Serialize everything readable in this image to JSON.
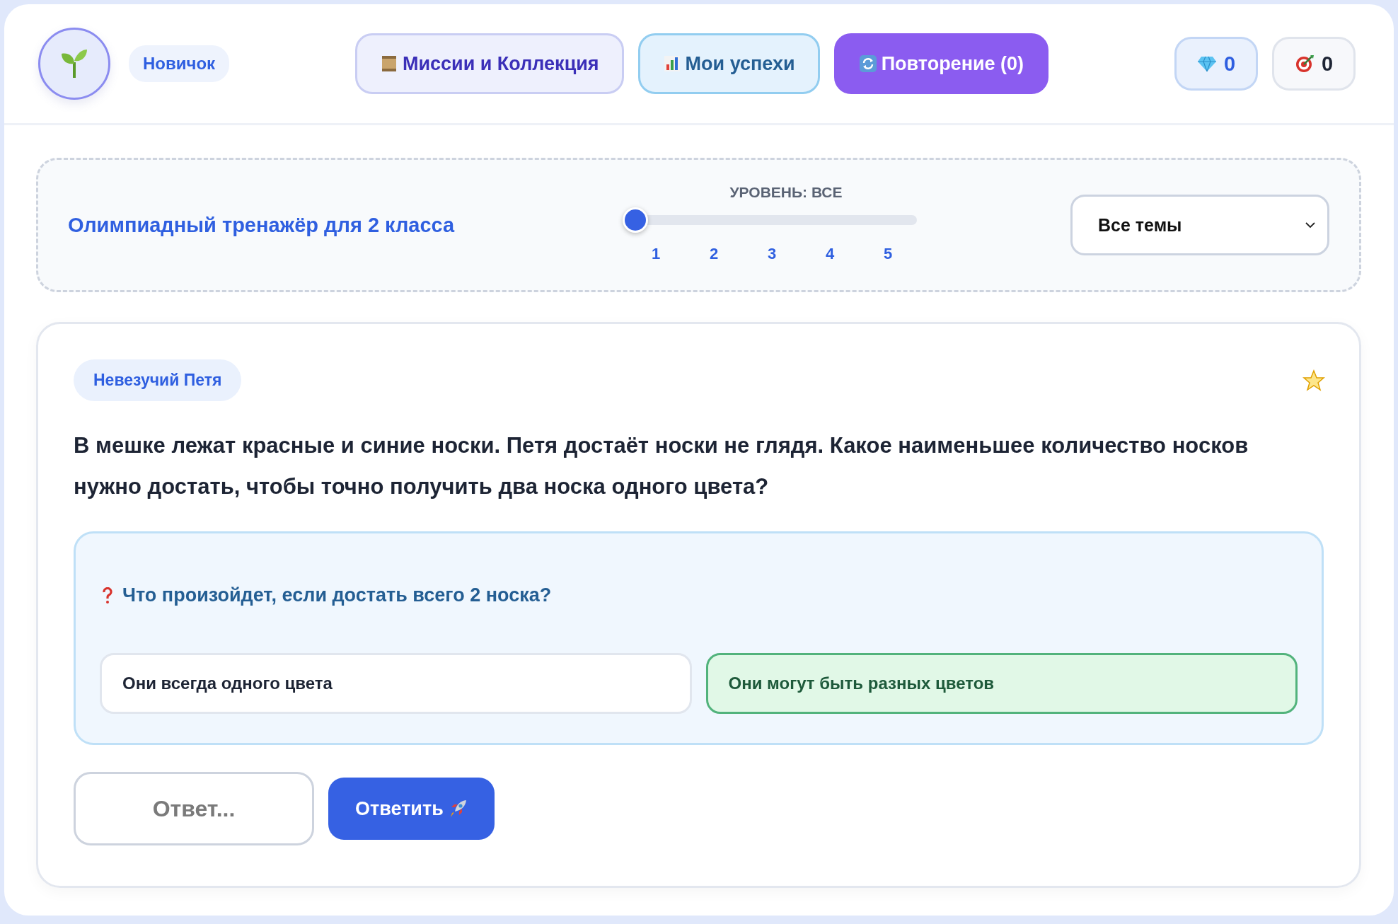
{
  "header": {
    "rank": "Новичок",
    "nav": [
      {
        "kind": "missions",
        "label": "Миссии и Коллекция",
        "selected": false
      },
      {
        "kind": "progress",
        "label": "Мои успехи",
        "selected": false
      },
      {
        "kind": "review",
        "label": "Повторение (0)",
        "selected": true
      }
    ],
    "stats": [
      {
        "kind": "gems",
        "value": "0"
      },
      {
        "kind": "target",
        "value": "0"
      }
    ]
  },
  "filter": {
    "title": "Олимпиадный тренажёр для 2 класса",
    "level_label": "УРОВЕНЬ: ВСЕ",
    "level": 0,
    "ticks": [
      "1",
      "2",
      "3",
      "4",
      "5"
    ],
    "topic": "Все темы"
  },
  "task": {
    "tag": "Невезучий Петя",
    "favorite": false,
    "question": "В мешке лежат красные и синие носки. Петя достаёт носки не глядя. Какое наименьшее количество носков нужно достать, чтобы точно получить два носка одного цвета?",
    "hint": {
      "question": "Что произойдет, если достать всего 2 носка?",
      "options": [
        {
          "label": "Они всегда одного цвета",
          "selected": false
        },
        {
          "label": "Они могут быть разных цветов",
          "selected": true
        }
      ]
    },
    "answer": {
      "placeholder": "Ответ..."
    },
    "submit": "Ответить"
  }
}
